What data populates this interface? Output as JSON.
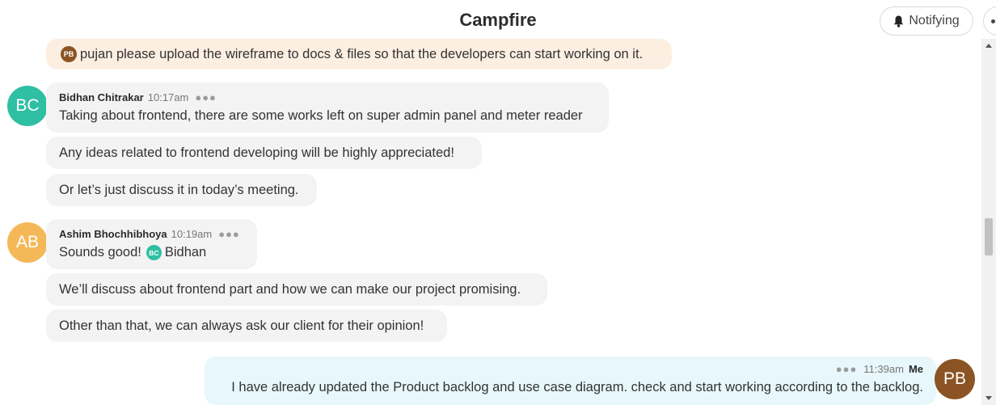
{
  "header": {
    "title": "Campfire",
    "notify_label": "Notifying",
    "notify_icon": "bell-icon",
    "more_icon": "ellipsis-icon"
  },
  "colors": {
    "bidhan": "#2fbfa3",
    "ashim": "#f5b859",
    "me": "#8c5424",
    "boost_bg": "#fcefe1",
    "mine_bg": "#e7f7fb"
  },
  "boost": {
    "avatar_initials": "PB",
    "text": "pujan please upload the wireframe to docs & files so that the developers can start working on it."
  },
  "messages": [
    {
      "avatar_initials": "BC",
      "author": "Bidhan Chitrakar",
      "time": "10:17am",
      "lines": [
        "Taking about frontend, there are some works left on super admin panel and meter reader",
        "Any ideas related to frontend developing will be highly appreciated!",
        "Or let’s just discuss it in today’s meeting."
      ]
    },
    {
      "avatar_initials": "AB",
      "author": "Ashim Bhochhibhoya",
      "time": "10:19am",
      "first_text": "Sounds good!",
      "mention_initials": "BC",
      "mention_name": "Bidhan",
      "lines": [
        "We’ll discuss about frontend part and how we can make our project promising.",
        "Other than that, we can always ask our client for their opinion!"
      ]
    }
  ],
  "my_message": {
    "time": "11:39am",
    "author": "Me",
    "avatar_initials": "PB",
    "text": "I have already updated the Product backlog and use case diagram. check and start working according to the backlog."
  }
}
